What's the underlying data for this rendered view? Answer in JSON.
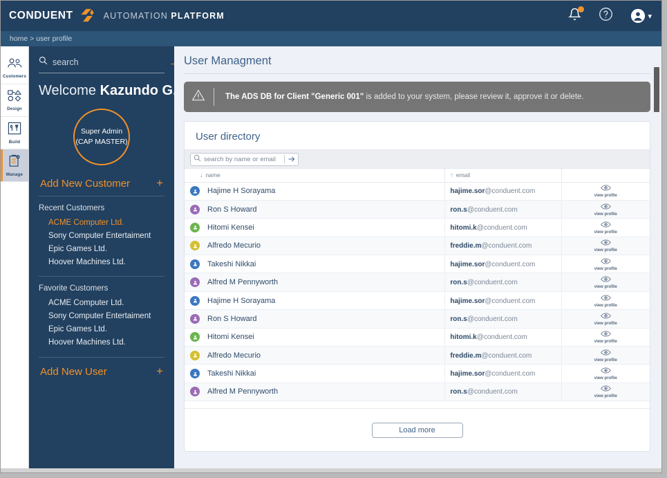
{
  "header": {
    "logo_text": "CONDUENT",
    "logo_mark_icon": "conduent-arrow-mark",
    "platform_prefix": "AUTOMATION ",
    "platform_bold": "PLATFORM",
    "notifications_icon": "bell-icon",
    "help_icon": "question-circle-icon",
    "account_icon": "user-avatar-icon",
    "account_chevron": "▾",
    "accent_color": "#f0922b",
    "bar_color": "#22405f"
  },
  "breadcrumb": {
    "text": "home > user profile"
  },
  "rail": {
    "items": [
      {
        "label": "Customers",
        "icon": "customers-people-icon",
        "active": false
      },
      {
        "label": "Design",
        "icon": "design-shapes-icon",
        "active": false
      },
      {
        "label": "Build",
        "icon": "build-tools-icon",
        "active": false
      },
      {
        "label": "Manage",
        "icon": "manage-clipboard-icon",
        "active": true
      }
    ]
  },
  "left_panel": {
    "search": {
      "placeholder": "search",
      "value": "",
      "icon": "search-icon",
      "submit_icon": "arrow-right-icon"
    },
    "welcome_prefix": "Welcome",
    "user_name": "Kazundo G.",
    "role_line1": "Super Admin",
    "role_line2": "(CAP MASTER)",
    "add_customer_label": "Add New Customer",
    "add_customer_plus": "+",
    "recent_title": "Recent Customers",
    "recent_customers": [
      "ACME Computer Ltd.",
      "Sony Computer Entertaiment",
      "Epic Games Ltd.",
      "Hoover Machines Ltd."
    ],
    "favorite_title": "Favorite Customers",
    "favorite_customers": [
      "ACME Computer Ltd.",
      "Sony Computer Entertaiment",
      "Epic Games Ltd.",
      "Hoover Machines Ltd."
    ],
    "add_user_label": "Add New User",
    "add_user_plus": "+"
  },
  "main": {
    "page_title": "User Managment",
    "alert": {
      "icon": "warning-triangle-icon",
      "bold_text": "The ADS DB for Client \"Generic 001\"",
      "rest_text": " is added to your system, please review it, approve it or delete.",
      "background": "#757575"
    },
    "card_title": "User directory",
    "table_search": {
      "placeholder": "search by name or email",
      "value": "",
      "icon": "search-icon",
      "submit_icon": "arrow-right-icon"
    },
    "columns": [
      {
        "label": "name",
        "sort_arrow": "↓"
      },
      {
        "label": "email",
        "sort_arrow": "↑"
      },
      {
        "label": "",
        "sort_arrow": ""
      }
    ],
    "action_label": "view profile",
    "action_icon": "eye-icon",
    "rows": [
      {
        "name": "Hajime H Sorayama",
        "email_user": "hajime.sor",
        "email_domain": "@conduent.com",
        "avatar_color": "#3b78bf"
      },
      {
        "name": "Ron S Howard",
        "email_user": "ron.s",
        "email_domain": "@conduent.com",
        "avatar_color": "#9b6bb5"
      },
      {
        "name": "Hitomi Kensei",
        "email_user": "hitomi.k",
        "email_domain": "@conduent.com",
        "avatar_color": "#6bb550"
      },
      {
        "name": "Alfredo Mecurio",
        "email_user": "freddie.m",
        "email_domain": "@conduent.com",
        "avatar_color": "#d4c030"
      },
      {
        "name": "Takeshi Nikkai",
        "email_user": "hajime.sor",
        "email_domain": "@conduent.com",
        "avatar_color": "#3b78bf"
      },
      {
        "name": "Alfred M Pennyworth",
        "email_user": "ron.s",
        "email_domain": "@conduent.com",
        "avatar_color": "#9b6bb5"
      },
      {
        "name": "Hajime H Sorayama",
        "email_user": "hajime.sor",
        "email_domain": "@conduent.com",
        "avatar_color": "#3b78bf"
      },
      {
        "name": "Ron S Howard",
        "email_user": "ron.s",
        "email_domain": "@conduent.com",
        "avatar_color": "#9b6bb5"
      },
      {
        "name": "Hitomi Kensei",
        "email_user": "hitomi.k",
        "email_domain": "@conduent.com",
        "avatar_color": "#6bb550"
      },
      {
        "name": "Alfredo Mecurio",
        "email_user": "freddie.m",
        "email_domain": "@conduent.com",
        "avatar_color": "#d4c030"
      },
      {
        "name": "Takeshi Nikkai",
        "email_user": "hajime.sor",
        "email_domain": "@conduent.com",
        "avatar_color": "#3b78bf"
      },
      {
        "name": "Alfred M Pennyworth",
        "email_user": "ron.s",
        "email_domain": "@conduent.com",
        "avatar_color": "#9b6bb5"
      }
    ],
    "load_more_label": "Load more"
  }
}
